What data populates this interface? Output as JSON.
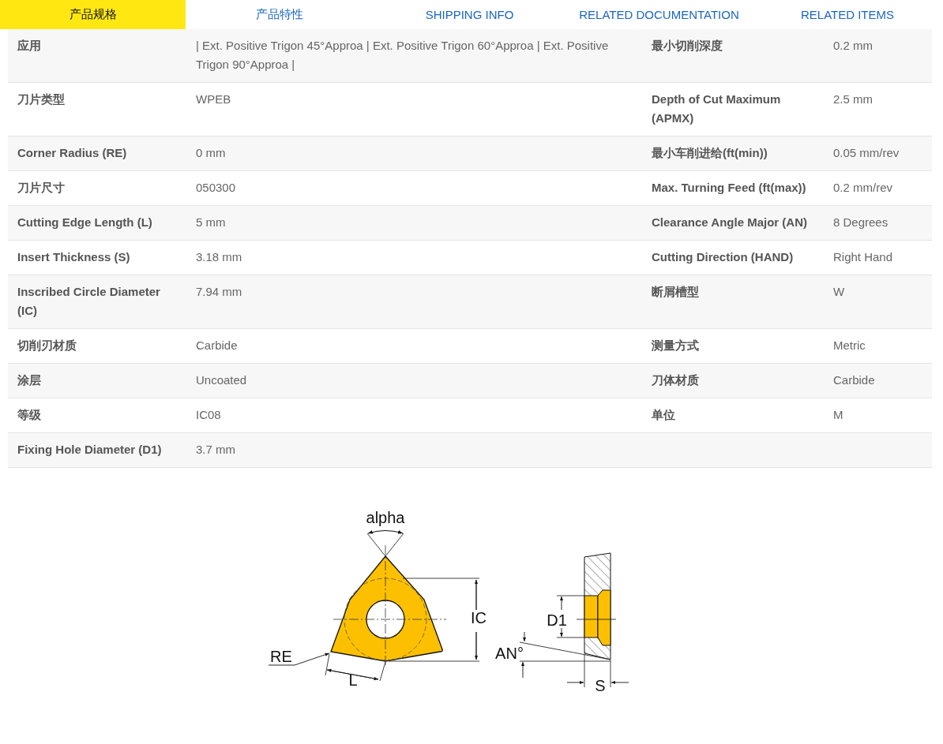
{
  "tabs": [
    {
      "label": "产品规格",
      "selected": true
    },
    {
      "label": "产品特性",
      "selected": false
    },
    {
      "label": "SHIPPING INFO",
      "selected": false
    },
    {
      "label": "RELATED DOCUMENTATION",
      "selected": false
    },
    {
      "label": "RELATED ITEMS",
      "selected": false
    }
  ],
  "spec_rows": [
    {
      "label_1": "应用",
      "value_1": "| Ext. Positive Trigon 45°Approa | Ext. Positive Trigon 60°Approa | Ext. Positive Trigon 90°Approa |",
      "label_2": "最小切削深度",
      "value_2": "0.2 mm"
    },
    {
      "label_1": "刀片类型",
      "value_1": "WPEB",
      "label_2": "Depth of Cut Maximum (APMX)",
      "value_2": "2.5 mm"
    },
    {
      "label_1": "Corner Radius (RE)",
      "value_1": "0 mm",
      "label_2": "最小车削进给(ft(min))",
      "value_2": "0.05 mm/rev"
    },
    {
      "label_1": "刀片尺寸",
      "value_1": "050300",
      "label_2": "Max. Turning Feed (ft(max))",
      "value_2": "0.2 mm/rev"
    },
    {
      "label_1": "Cutting Edge Length (L)",
      "value_1": "5 mm",
      "label_2": "Clearance Angle Major (AN)",
      "value_2": "8 Degrees"
    },
    {
      "label_1": "Insert Thickness (S)",
      "value_1": "3.18 mm",
      "label_2": "Cutting Direction (HAND)",
      "value_2": "Right Hand"
    },
    {
      "label_1": "Inscribed Circle Diameter (IC)",
      "value_1": "7.94 mm",
      "label_2": "断屑槽型",
      "value_2": "W"
    },
    {
      "label_1": "切削刃材质",
      "value_1": "Carbide",
      "label_2": "测量方式",
      "value_2": "Metric"
    },
    {
      "label_1": "涂层",
      "value_1": "Uncoated",
      "label_2": "刀体材质",
      "value_2": "Carbide"
    },
    {
      "label_1": "等级",
      "value_1": "IC08",
      "label_2": "单位",
      "value_2": "M"
    },
    {
      "label_1": "Fixing Hole Diameter (D1)",
      "value_1": "3.7 mm"
    }
  ],
  "diagram": {
    "labels": [
      "alpha",
      "IC",
      "RE",
      "L",
      "D1",
      "AN°",
      "S"
    ]
  }
}
